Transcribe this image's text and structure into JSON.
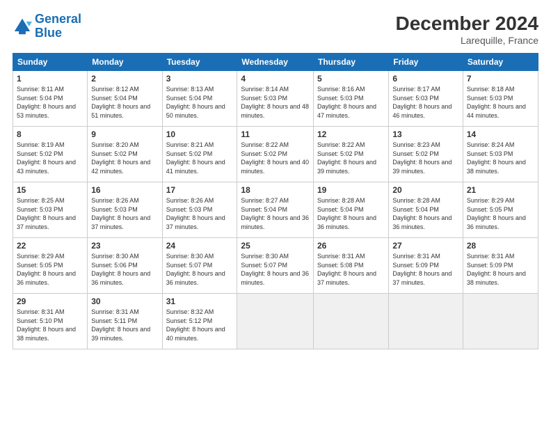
{
  "header": {
    "logo_line1": "General",
    "logo_line2": "Blue",
    "title": "December 2024",
    "subtitle": "Larequille, France"
  },
  "weekdays": [
    "Sunday",
    "Monday",
    "Tuesday",
    "Wednesday",
    "Thursday",
    "Friday",
    "Saturday"
  ],
  "weeks": [
    [
      {
        "day": "1",
        "sunrise": "8:11 AM",
        "sunset": "5:04 PM",
        "daylight": "8 hours and 53 minutes."
      },
      {
        "day": "2",
        "sunrise": "8:12 AM",
        "sunset": "5:04 PM",
        "daylight": "8 hours and 51 minutes."
      },
      {
        "day": "3",
        "sunrise": "8:13 AM",
        "sunset": "5:04 PM",
        "daylight": "8 hours and 50 minutes."
      },
      {
        "day": "4",
        "sunrise": "8:14 AM",
        "sunset": "5:03 PM",
        "daylight": "8 hours and 48 minutes."
      },
      {
        "day": "5",
        "sunrise": "8:16 AM",
        "sunset": "5:03 PM",
        "daylight": "8 hours and 47 minutes."
      },
      {
        "day": "6",
        "sunrise": "8:17 AM",
        "sunset": "5:03 PM",
        "daylight": "8 hours and 46 minutes."
      },
      {
        "day": "7",
        "sunrise": "8:18 AM",
        "sunset": "5:03 PM",
        "daylight": "8 hours and 44 minutes."
      }
    ],
    [
      {
        "day": "8",
        "sunrise": "8:19 AM",
        "sunset": "5:02 PM",
        "daylight": "8 hours and 43 minutes."
      },
      {
        "day": "9",
        "sunrise": "8:20 AM",
        "sunset": "5:02 PM",
        "daylight": "8 hours and 42 minutes."
      },
      {
        "day": "10",
        "sunrise": "8:21 AM",
        "sunset": "5:02 PM",
        "daylight": "8 hours and 41 minutes."
      },
      {
        "day": "11",
        "sunrise": "8:22 AM",
        "sunset": "5:02 PM",
        "daylight": "8 hours and 40 minutes."
      },
      {
        "day": "12",
        "sunrise": "8:22 AM",
        "sunset": "5:02 PM",
        "daylight": "8 hours and 39 minutes."
      },
      {
        "day": "13",
        "sunrise": "8:23 AM",
        "sunset": "5:02 PM",
        "daylight": "8 hours and 39 minutes."
      },
      {
        "day": "14",
        "sunrise": "8:24 AM",
        "sunset": "5:03 PM",
        "daylight": "8 hours and 38 minutes."
      }
    ],
    [
      {
        "day": "15",
        "sunrise": "8:25 AM",
        "sunset": "5:03 PM",
        "daylight": "8 hours and 37 minutes."
      },
      {
        "day": "16",
        "sunrise": "8:26 AM",
        "sunset": "5:03 PM",
        "daylight": "8 hours and 37 minutes."
      },
      {
        "day": "17",
        "sunrise": "8:26 AM",
        "sunset": "5:03 PM",
        "daylight": "8 hours and 37 minutes."
      },
      {
        "day": "18",
        "sunrise": "8:27 AM",
        "sunset": "5:04 PM",
        "daylight": "8 hours and 36 minutes."
      },
      {
        "day": "19",
        "sunrise": "8:28 AM",
        "sunset": "5:04 PM",
        "daylight": "8 hours and 36 minutes."
      },
      {
        "day": "20",
        "sunrise": "8:28 AM",
        "sunset": "5:04 PM",
        "daylight": "8 hours and 36 minutes."
      },
      {
        "day": "21",
        "sunrise": "8:29 AM",
        "sunset": "5:05 PM",
        "daylight": "8 hours and 36 minutes."
      }
    ],
    [
      {
        "day": "22",
        "sunrise": "8:29 AM",
        "sunset": "5:05 PM",
        "daylight": "8 hours and 36 minutes."
      },
      {
        "day": "23",
        "sunrise": "8:30 AM",
        "sunset": "5:06 PM",
        "daylight": "8 hours and 36 minutes."
      },
      {
        "day": "24",
        "sunrise": "8:30 AM",
        "sunset": "5:07 PM",
        "daylight": "8 hours and 36 minutes."
      },
      {
        "day": "25",
        "sunrise": "8:30 AM",
        "sunset": "5:07 PM",
        "daylight": "8 hours and 36 minutes."
      },
      {
        "day": "26",
        "sunrise": "8:31 AM",
        "sunset": "5:08 PM",
        "daylight": "8 hours and 37 minutes."
      },
      {
        "day": "27",
        "sunrise": "8:31 AM",
        "sunset": "5:09 PM",
        "daylight": "8 hours and 37 minutes."
      },
      {
        "day": "28",
        "sunrise": "8:31 AM",
        "sunset": "5:09 PM",
        "daylight": "8 hours and 38 minutes."
      }
    ],
    [
      {
        "day": "29",
        "sunrise": "8:31 AM",
        "sunset": "5:10 PM",
        "daylight": "8 hours and 38 minutes."
      },
      {
        "day": "30",
        "sunrise": "8:31 AM",
        "sunset": "5:11 PM",
        "daylight": "8 hours and 39 minutes."
      },
      {
        "day": "31",
        "sunrise": "8:32 AM",
        "sunset": "5:12 PM",
        "daylight": "8 hours and 40 minutes."
      },
      null,
      null,
      null,
      null
    ]
  ],
  "labels": {
    "sunrise": "Sunrise:",
    "sunset": "Sunset:",
    "daylight": "Daylight:"
  }
}
